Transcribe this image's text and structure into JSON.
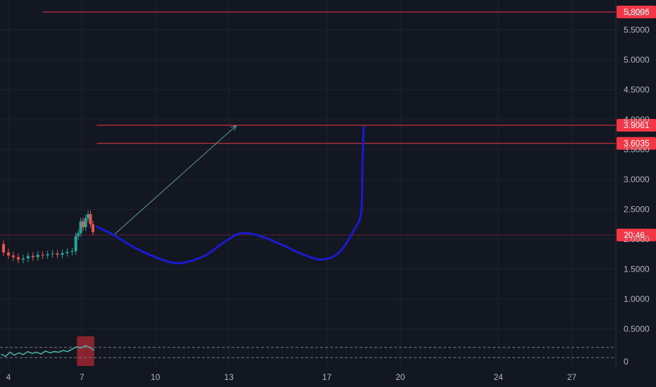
{
  "chart_data": {
    "type": "line",
    "price_unit": "USDT",
    "y_ticks": [
      "5.5000",
      "5.0000",
      "4.5000",
      "4.0000",
      "3.5000",
      "3.0000",
      "2.5000",
      "2.0000",
      "1.5000",
      "1.0000",
      "0.5000"
    ],
    "x_ticks": [
      "4",
      "7",
      "10",
      "13",
      "17",
      "20",
      "24",
      "27"
    ],
    "horizontal_lines": [
      {
        "label": "5.8006",
        "value": 5.8006,
        "start_day": 5.4
      },
      {
        "label": "3.9061",
        "value": 3.9061,
        "start_day": 7.6
      },
      {
        "label": "3.6035",
        "value": 3.6035,
        "start_day": 7.6
      }
    ],
    "current_price_tag": "20:46",
    "current_price": 2.07,
    "price_series": {
      "name": "",
      "x": [
        3.6,
        3.8,
        4.0,
        4.2,
        4.4,
        4.6,
        4.8,
        5.0,
        5.2,
        5.4,
        5.6,
        5.8,
        6.0,
        6.2,
        6.4,
        6.6,
        6.75,
        6.85,
        6.95,
        7.05,
        7.15,
        7.25,
        7.35,
        7.45
      ],
      "y": [
        1.92,
        1.78,
        1.73,
        1.7,
        1.66,
        1.68,
        1.72,
        1.7,
        1.74,
        1.73,
        1.75,
        1.76,
        1.74,
        1.77,
        1.79,
        1.8,
        2.05,
        2.1,
        2.3,
        2.2,
        2.35,
        2.42,
        2.25,
        2.12
      ]
    },
    "drawn_curve": {
      "x": [
        7.6,
        8.3,
        9.2,
        10.2,
        11.0,
        12.0,
        12.8,
        13.5,
        14.3,
        15.2,
        16.0,
        16.8,
        17.5,
        18.1,
        18.4,
        18.45,
        18.5
      ],
      "y": [
        2.21,
        2.07,
        1.85,
        1.67,
        1.6,
        1.72,
        1.95,
        2.1,
        2.05,
        1.9,
        1.75,
        1.66,
        1.78,
        2.15,
        2.45,
        3.2,
        3.88
      ]
    },
    "arrow": {
      "from": [
        8.3,
        2.07
      ],
      "to": [
        13.3,
        3.9
      ]
    },
    "indicator": {
      "upper": 0.25,
      "lower": 0.08,
      "highlight_days": [
        6.8,
        7.5
      ],
      "series": [
        0.14,
        0.1,
        0.17,
        0.12,
        0.16,
        0.13,
        0.18,
        0.15,
        0.17,
        0.14,
        0.19,
        0.16,
        0.18,
        0.17,
        0.2,
        0.18,
        0.22,
        0.26,
        0.24,
        0.28,
        0.25,
        0.2
      ]
    }
  },
  "colors": {
    "background": "#131722",
    "grid": "#1e222d",
    "level_line": "#f23645",
    "current_price_line": "#f23645",
    "drawn_curve": "#1a1ad2",
    "arrow": "#5b9aa0",
    "candle_up": "#26a69a",
    "candle_down": "#ef5350",
    "indicator_line": "#4db6ac",
    "indicator_band": "#787b86",
    "indicator_highlight": "#b22833"
  }
}
